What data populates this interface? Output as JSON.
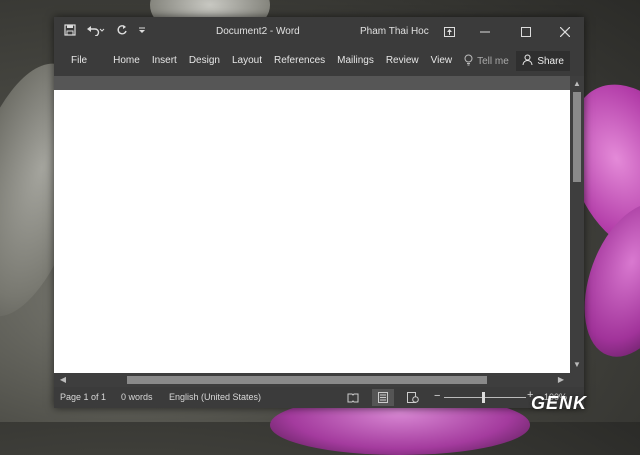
{
  "window": {
    "title": "Document2 - Word",
    "user": "Pham Thai Hoc"
  },
  "quick_access": {
    "save_icon": "save-icon",
    "undo_icon": "undo-icon",
    "redo_icon": "redo-icon",
    "customize_icon": "customize-icon"
  },
  "window_controls": {
    "ribbon_options": "ribbon-display-options-icon",
    "minimize": "minimize-icon",
    "maximize": "maximize-icon",
    "close": "close-icon"
  },
  "ribbon": {
    "tabs": [
      {
        "label": "File"
      },
      {
        "label": "Home"
      },
      {
        "label": "Insert"
      },
      {
        "label": "Design"
      },
      {
        "label": "Layout"
      },
      {
        "label": "References"
      },
      {
        "label": "Mailings"
      },
      {
        "label": "Review"
      },
      {
        "label": "View"
      }
    ],
    "tell_me": "Tell me",
    "share": "Share"
  },
  "status": {
    "page": "Page 1 of 1",
    "words": "0 words",
    "language": "English (United States)",
    "zoom": "100%"
  },
  "watermark": "GENK"
}
